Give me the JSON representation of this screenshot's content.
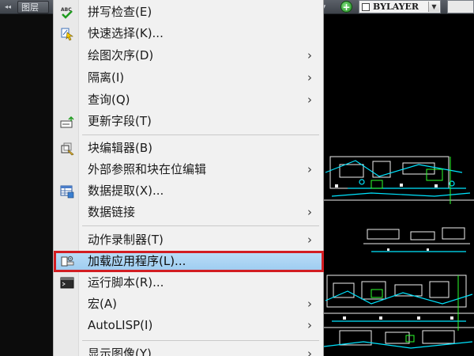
{
  "toolbar": {
    "left_tab": "图层",
    "linetype_value": "BYLAYER"
  },
  "menu": {
    "items": [
      {
        "label": "拼写检查(E)",
        "icon": "spell-check-icon",
        "icon_text": "ABC",
        "submenu": false
      },
      {
        "label": "快速选择(K)...",
        "icon": "quick-select-icon",
        "submenu": false
      },
      {
        "label": "绘图次序(D)",
        "icon": "",
        "submenu": true
      },
      {
        "label": "隔离(I)",
        "icon": "",
        "submenu": true
      },
      {
        "label": "查询(Q)",
        "icon": "",
        "submenu": true
      },
      {
        "label": "更新字段(T)",
        "icon": "update-fields-icon",
        "submenu": false
      },
      {
        "label": "块编辑器(B)",
        "icon": "block-editor-icon",
        "submenu": false
      },
      {
        "label": "外部参照和块在位编辑",
        "icon": "",
        "submenu": true
      },
      {
        "label": "数据提取(X)...",
        "icon": "data-extraction-icon",
        "submenu": false
      },
      {
        "label": "数据链接",
        "icon": "",
        "submenu": true
      },
      {
        "label": "动作录制器(T)",
        "icon": "",
        "submenu": true
      },
      {
        "label": "加载应用程序(L)...",
        "icon": "load-application-icon",
        "submenu": false,
        "highlighted": true
      },
      {
        "label": "运行脚本(R)...",
        "icon": "run-script-icon",
        "submenu": false
      },
      {
        "label": "宏(A)",
        "icon": "",
        "submenu": true
      },
      {
        "label": "AutoLISP(I)",
        "icon": "",
        "submenu": true
      },
      {
        "label": "显示图像(Y)",
        "icon": "",
        "submenu": true
      }
    ],
    "submenu_arrow": "›"
  },
  "colors": {
    "highlight_fill": "#a9d3f4",
    "highlight_border": "#d21d22",
    "cad_cyan": "#00e5ff",
    "cad_green": "#2dff2d",
    "cad_white": "#f0f0f0"
  }
}
